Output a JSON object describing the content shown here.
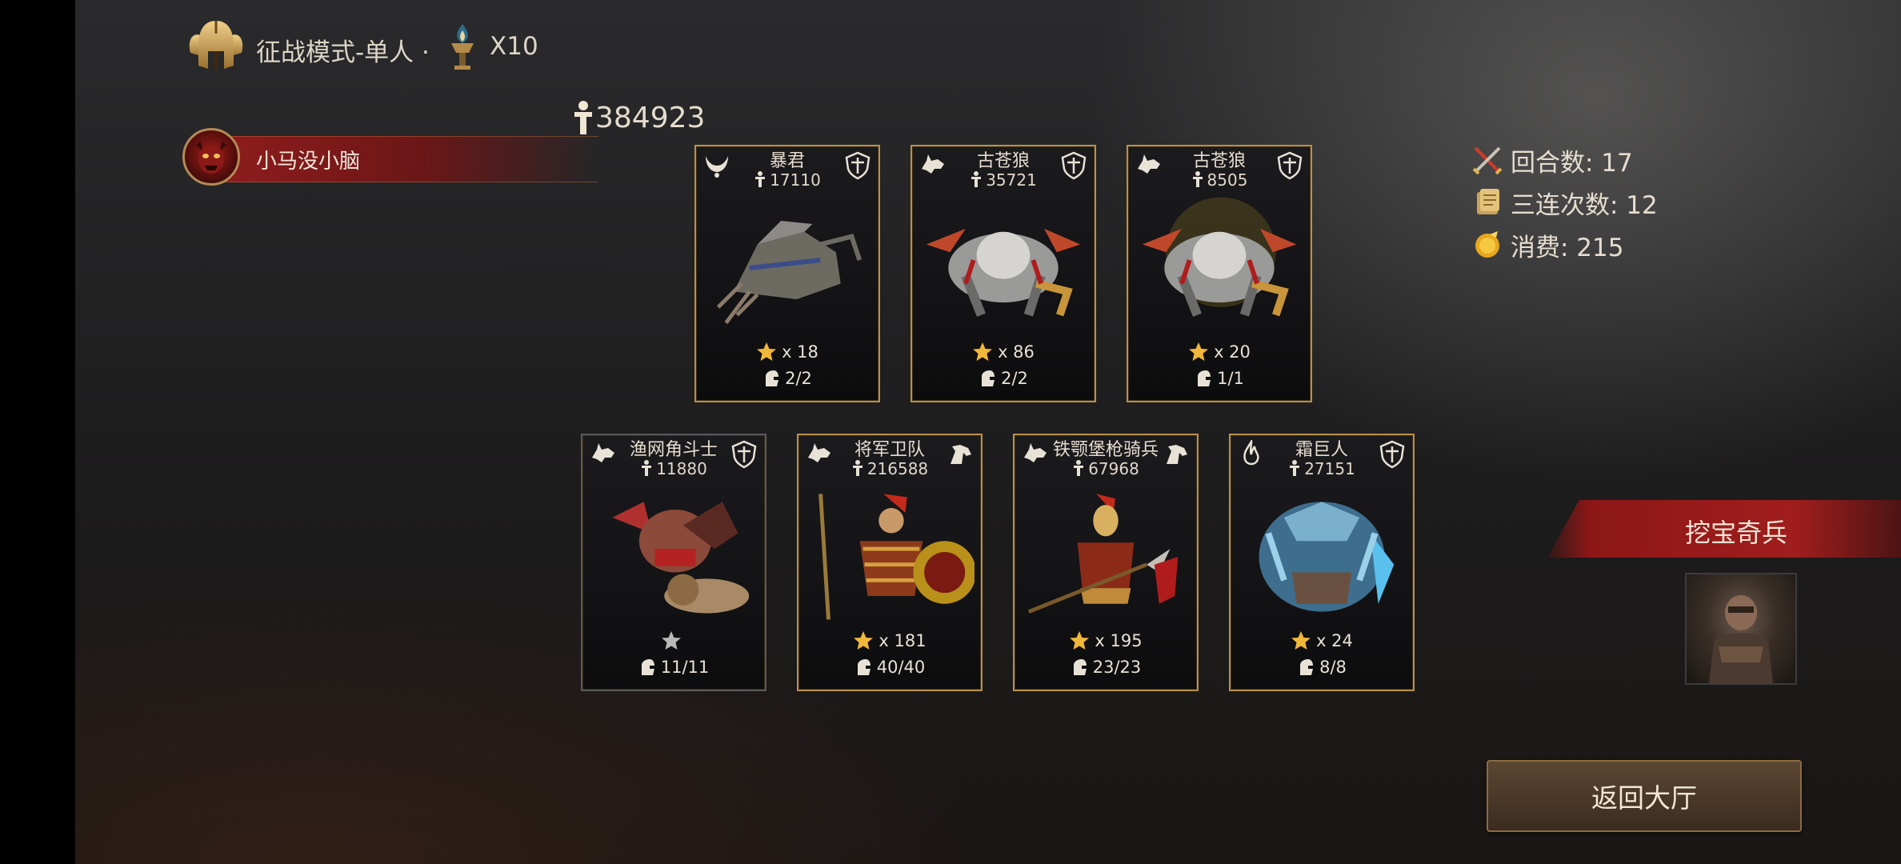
{
  "header": {
    "mode_title": "征战模式-单人 ·",
    "multiplier": "X10",
    "emblem_icon": "spartan-helmet-icon",
    "torch_icon": "torch-icon"
  },
  "player": {
    "name": "小马没小脑",
    "avatar_icon": "demon-face-avatar"
  },
  "total_power": {
    "icon": "power-figure-icon",
    "value": "384923"
  },
  "cards_row1": [
    {
      "name": "暴君",
      "power": "17110",
      "stars": "x 18",
      "troops": "2/2",
      "corner_left": "horns-icon",
      "corner_right": "shield-icon",
      "art": "siege-war-machine",
      "star_color": "#f1b73a"
    },
    {
      "name": "古苍狼",
      "power": "35721",
      "stars": "x 86",
      "troops": "2/2",
      "corner_left": "wolf-icon",
      "corner_right": "shield-icon",
      "art": "armored-war-wolf",
      "star_color": "#f1b73a"
    },
    {
      "name": "古苍狼",
      "power": "8505",
      "stars": "x 20",
      "troops": "1/1",
      "corner_left": "wolf-icon",
      "corner_right": "shield-icon",
      "art": "armored-war-wolf-golden",
      "star_color": "#f1b73a"
    }
  ],
  "cards_row2": [
    {
      "name": "渔网角斗士",
      "power": "11880",
      "stars": "",
      "troops": "11/11",
      "corner_left": "wolf-icon",
      "corner_right": "shield-icon",
      "art": "net-gladiator-with-lion",
      "star_color": "#b8b8b8",
      "gray": true
    },
    {
      "name": "将军卫队",
      "power": "216588",
      "stars": "x 181",
      "troops": "40/40",
      "corner_left": "wolf-icon",
      "corner_right": "horse-icon",
      "art": "roman-guard-with-shield",
      "star_color": "#f1b73a"
    },
    {
      "name": "铁颚堡枪骑兵",
      "power": "67968",
      "stars": "x 195",
      "troops": "23/23",
      "corner_left": "wolf-icon",
      "corner_right": "horse-icon",
      "art": "spear-cavalry-soldier",
      "star_color": "#f1b73a"
    },
    {
      "name": "霜巨人",
      "power": "27151",
      "stars": "x 24",
      "troops": "8/8",
      "corner_left": "flame-icon",
      "corner_right": "shield-icon",
      "art": "frost-giant",
      "star_color": "#f1b73a"
    }
  ],
  "stats": {
    "rounds_label": "回合数: 17",
    "triple_label": "三连次数: 12",
    "cost_label": "消费: 215",
    "rounds_icon": "crossed-swords-icon",
    "triple_icon": "scroll-icon",
    "cost_icon": "gold-coin-icon"
  },
  "treasure": {
    "label": "挖宝奇兵",
    "thumb_icon": "warrior-portrait"
  },
  "return_button": "返回大厅",
  "colors": {
    "gold_border": "#b8914c",
    "banner_red": "#a01d1d",
    "star_gold": "#f1b73a"
  }
}
